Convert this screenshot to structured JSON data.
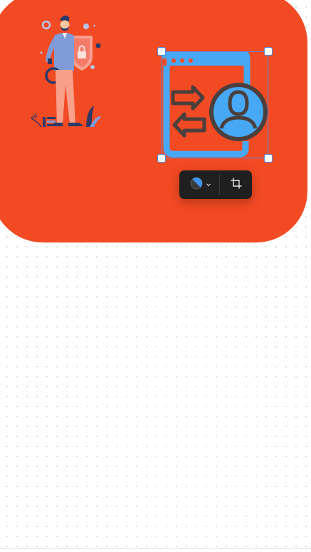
{
  "canvas": {
    "background_color": "#f24a23",
    "dot_grid_color": "#d8d8d8"
  },
  "illustration": {
    "name": "security-person-illustration",
    "colors": {
      "suit": "#7f9cd8",
      "pants": "#f8a08a",
      "shield": "#f47a6a",
      "dark": "#2b3a67",
      "skin": "#f6c7a3"
    }
  },
  "selected_element": {
    "icon": "account-transfer-icon",
    "colors": {
      "window": "#47a8f5",
      "outline": "#4a3f3c",
      "selection": "#4c8ee8"
    }
  },
  "toolbar": {
    "color_picker_icon": "color-swatch-icon",
    "dropdown_icon": "chevron-down-icon",
    "crop_icon": "crop-icon",
    "swatch_colors": [
      "#3d95f0",
      "#3a3a3a"
    ]
  }
}
